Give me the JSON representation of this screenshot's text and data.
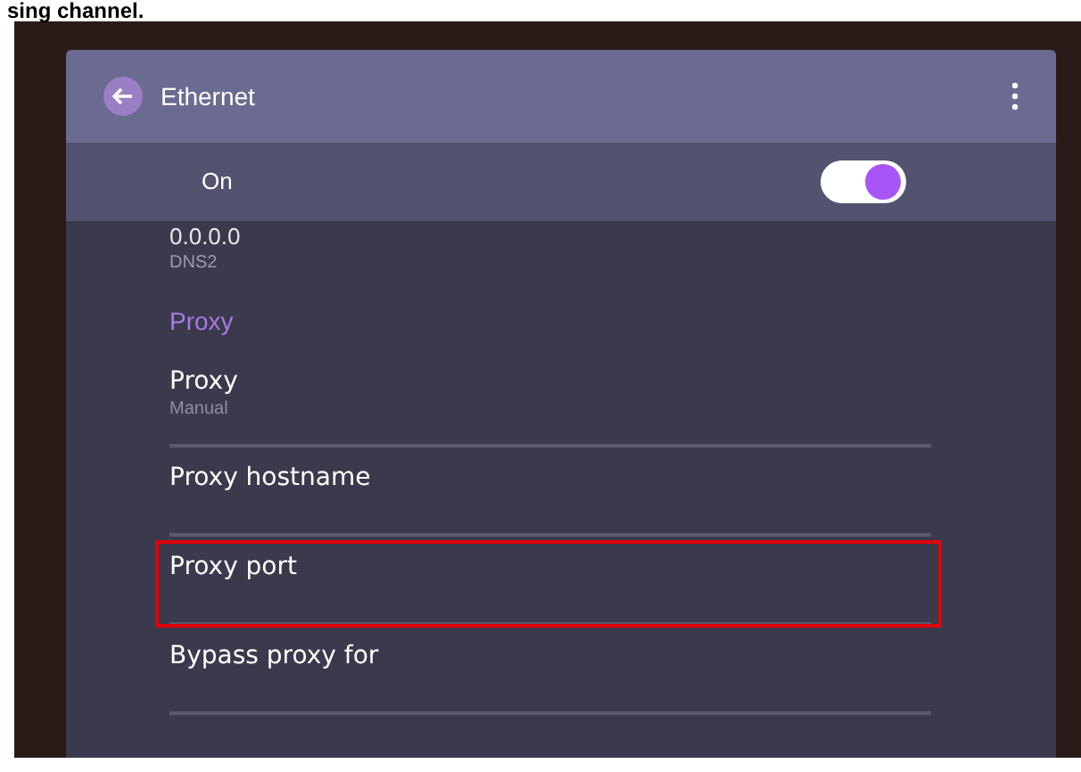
{
  "caption": "sing channel.",
  "window": {
    "title": "Ethernet"
  },
  "master_switch": {
    "label": "On",
    "on": true
  },
  "items": [
    {
      "kind": "value",
      "title": "0.0.0.0",
      "summary": "DNS2"
    },
    {
      "kind": "header",
      "title": "Proxy"
    },
    {
      "kind": "setting",
      "title": "Proxy",
      "summary": "Manual",
      "highlighted": false
    },
    {
      "kind": "setting",
      "title": "Proxy hostname",
      "highlighted": false
    },
    {
      "kind": "setting",
      "title": "Proxy port",
      "highlighted": true
    },
    {
      "kind": "setting",
      "title": "Bypass proxy for",
      "highlighted": false
    }
  ]
}
